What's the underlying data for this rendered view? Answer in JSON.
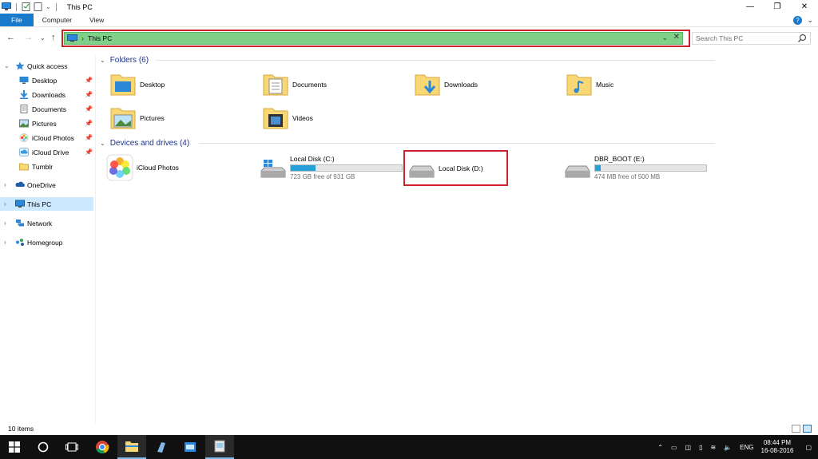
{
  "window": {
    "title": "This PC",
    "controls": {
      "minimize": "—",
      "maximize": "❐",
      "close": "✕"
    }
  },
  "ribbon": {
    "tabs": [
      "File",
      "Computer",
      "View"
    ],
    "expand": "⌄",
    "help": "?"
  },
  "nav": {
    "back": "←",
    "forward": "→",
    "recent": "⌄",
    "up": "↑",
    "address": {
      "chevron": "›",
      "location": "This PC",
      "dropdown": "⌄",
      "clear": "✕"
    },
    "search_placeholder": "Search This PC"
  },
  "sidebar": {
    "quick_access": "Quick access",
    "pinned": [
      {
        "label": "Desktop",
        "icon": "desktop-icon"
      },
      {
        "label": "Downloads",
        "icon": "downloads-icon"
      },
      {
        "label": "Documents",
        "icon": "documents-icon"
      },
      {
        "label": "Pictures",
        "icon": "pictures-icon"
      },
      {
        "label": "iCloud Photos",
        "icon": "icloud-photos-icon"
      },
      {
        "label": "iCloud Drive",
        "icon": "icloud-drive-icon"
      },
      {
        "label": "Tumblr",
        "icon": "folder-icon"
      }
    ],
    "onedrive": "OneDrive",
    "this_pc": "This PC",
    "network": "Network",
    "homegroup": "Homegroup"
  },
  "content": {
    "folders_header": "Folders (6)",
    "folders": [
      "Desktop",
      "Documents",
      "Downloads",
      "Music",
      "Pictures",
      "Videos"
    ],
    "devices_header": "Devices and drives (4)",
    "devices": [
      {
        "name": "iCloud Photos"
      },
      {
        "name": "Local Disk (C:)",
        "free": "723 GB free of 931 GB",
        "used_fraction": 0.22
      },
      {
        "name": "Local Disk (D:)"
      },
      {
        "name": "DBR_BOOT (E:)",
        "free": "474 MB free of 500 MB",
        "used_fraction": 0.05
      }
    ]
  },
  "status": {
    "items": "10 items"
  },
  "taskbar": {
    "tray": {
      "language": "ENG",
      "time": "08:44 PM",
      "date": "16-08-2016"
    }
  },
  "colors": {
    "accent": "#1979ca",
    "address_highlight": "#7fd18a",
    "annotation_red": "#d0202e",
    "drive_fill": "#26a0da"
  }
}
